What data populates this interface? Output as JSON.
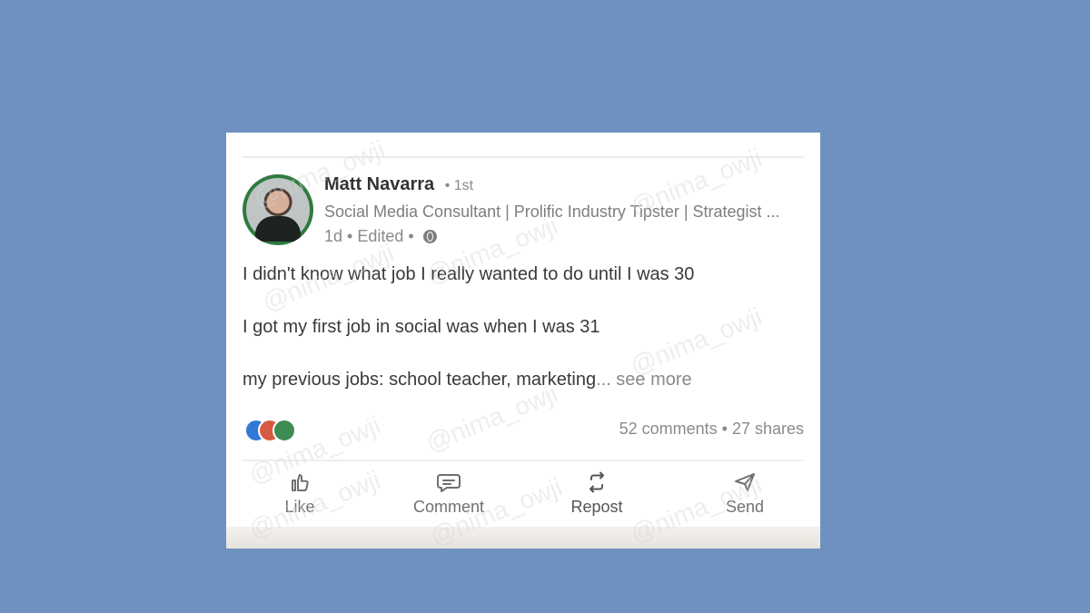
{
  "post": {
    "author_name": "Matt Navarra",
    "degree": "• 1st",
    "headline": "Social Media Consultant | Prolific Industry Tipster | Strategist ...",
    "meta": "1d • Edited •",
    "lines": [
      "I didn't know what job I really wanted to do until I was 30",
      "I got my first job in social was when I was 31",
      "my previous jobs: school teacher, marketing"
    ],
    "see_more": "... see more",
    "stats": "52 comments • 27 shares"
  },
  "actions": {
    "like": "Like",
    "comment": "Comment",
    "repost": "Repost",
    "send": "Send"
  },
  "watermark": "@nima_owji",
  "icons": {
    "avatar": "profile-photo",
    "visibility": "globe-icon",
    "reactions": [
      "like-reaction-icon",
      "love-reaction-icon",
      "support-reaction-icon"
    ],
    "actions": [
      "like-icon",
      "comment-icon",
      "repost-icon",
      "send-icon"
    ]
  },
  "colors": {
    "background": "#6f91bf",
    "card": "#ffffff",
    "text": "#3a3a3a",
    "secondary_text": "#8a8a8a",
    "like_reaction": "#3378d5",
    "love_reaction": "#d85a42",
    "support_reaction": "#3e8c55"
  }
}
